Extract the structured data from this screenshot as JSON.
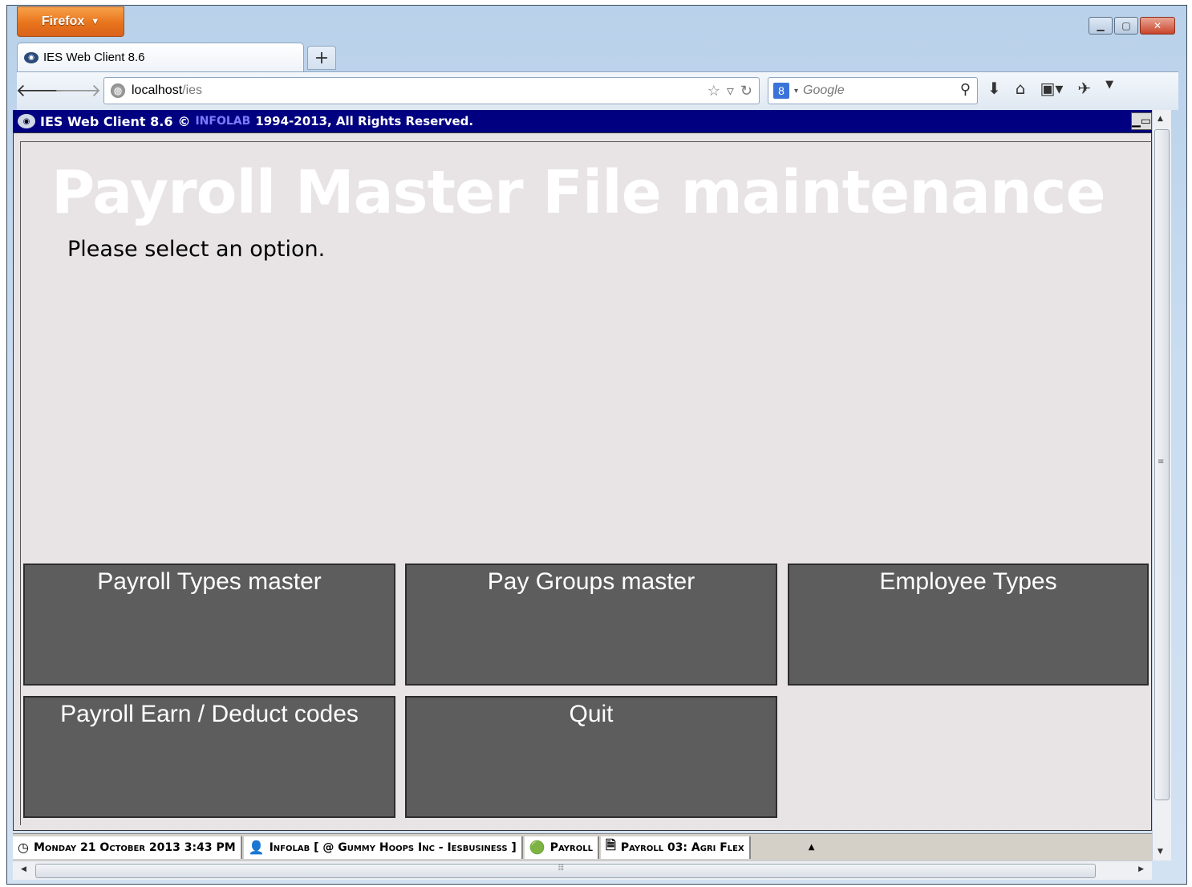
{
  "browser": {
    "app_button": "Firefox",
    "tab_title": "IES Web Client 8.6",
    "new_tab": "+",
    "url_host": "localhost",
    "url_path": "/ies",
    "search_placeholder": "Google",
    "search_badge": "8"
  },
  "app": {
    "title": "IES Web Client 8.6",
    "copyright_symbol": "©",
    "brand": "INFOLAB",
    "copyright": "1994-2013, All Rights Reserved."
  },
  "page": {
    "heading": "Payroll Master File maintenance",
    "prompt": "Please select an option."
  },
  "options": [
    {
      "label": "Payroll Types master"
    },
    {
      "label": "Pay Groups master"
    },
    {
      "label": "Employee Types"
    },
    {
      "label": "Payroll Earn / Deduct codes"
    },
    {
      "label": "Quit"
    }
  ],
  "status": {
    "datetime": "Monday 21 October 2013 3:43 PM",
    "user": "Infolab [ @ Gummy Hoops Inc - Iesbusiness ]",
    "module": "Payroll",
    "document": "Payroll 03: Agri Flex"
  }
}
